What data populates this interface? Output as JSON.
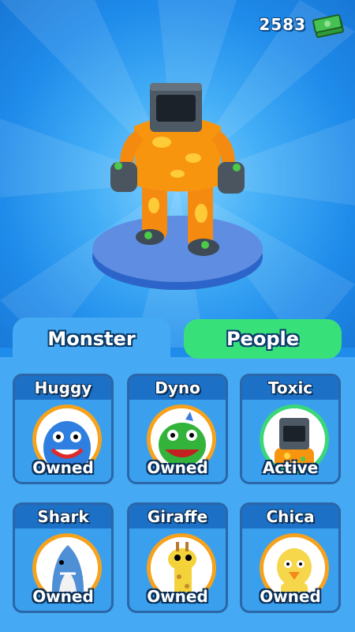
{
  "currency": {
    "amount": "2583",
    "icon": "cash-stack-icon"
  },
  "tabs": [
    {
      "label": "Monster",
      "selected": true
    },
    {
      "label": "People",
      "selected": false
    }
  ],
  "skins": [
    {
      "name": "Huggy",
      "status": "Owned"
    },
    {
      "name": "Dyno",
      "status": "Owned"
    },
    {
      "name": "Toxic",
      "status": "Active"
    },
    {
      "name": "Shark",
      "status": "Owned"
    },
    {
      "name": "Giraffe",
      "status": "Owned"
    },
    {
      "name": "Chica",
      "status": "Owned"
    }
  ],
  "colors": {
    "background": "#1f8bea",
    "panel": "#45aaf3",
    "tab_people": "#38e07a",
    "owned_ring": "#f7a21c",
    "active_ring": "#39d67a"
  }
}
